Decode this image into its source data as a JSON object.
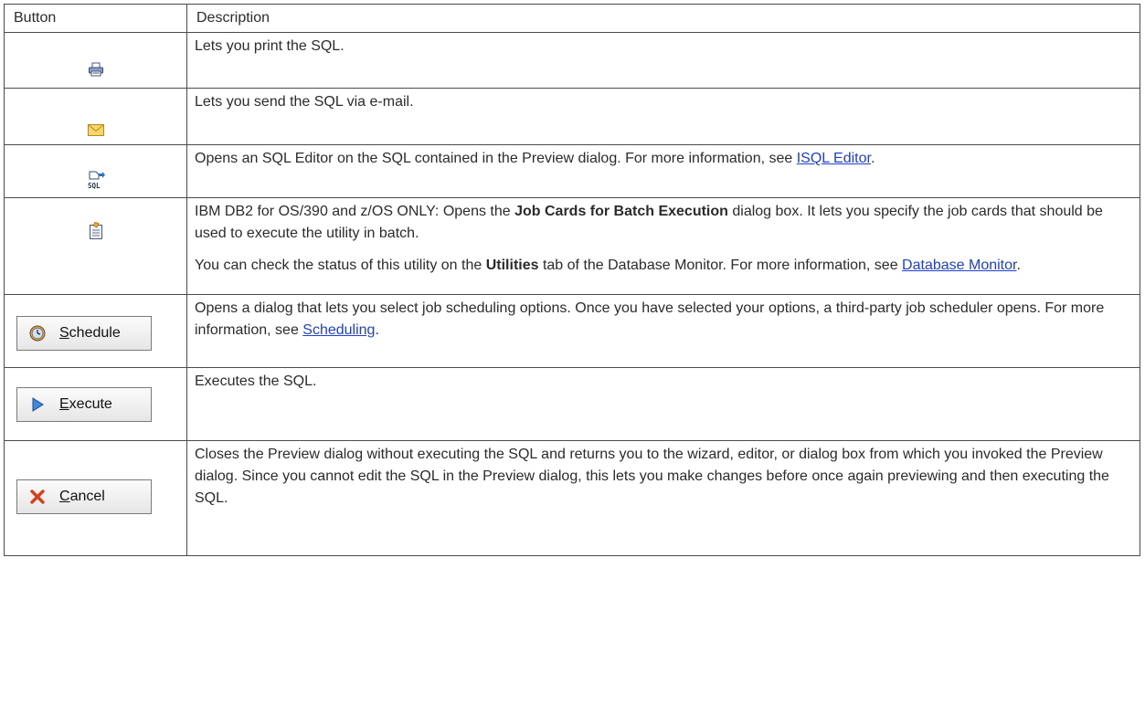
{
  "header": {
    "button_col": "Button",
    "description_col": "Description"
  },
  "rows": [
    {
      "icon": "print-icon",
      "description": "Lets you print the SQL."
    },
    {
      "icon": "email-icon",
      "description": "Lets you send the SQL via e-mail."
    },
    {
      "icon": "open-sql-editor-icon",
      "description_before": "Opens an SQL Editor on the SQL contained in the Preview dialog. For more information, see ",
      "link": "ISQL Editor",
      "description_after": "."
    },
    {
      "icon": "job-cards-icon",
      "p1_before": "IBM DB2 for OS/390 and z/OS ONLY: Opens the ",
      "p1_bold": "Job Cards for Batch Execution",
      "p1_after": " dialog box. It lets you specify the job cards that should be used to execute the utility in batch.",
      "p2_before": "You can check the status of this utility on the ",
      "p2_bold": "Utilities",
      "p2_mid": " tab of the Database Monitor.  For more information, see ",
      "p2_link": "Database Monitor",
      "p2_after": "."
    },
    {
      "button": {
        "label_first": "S",
        "label_rest": "chedule",
        "icon": "clock-icon"
      },
      "description_before": "Opens a dialog that lets you select job scheduling options.  Once you have selected your options, a third-party job scheduler opens. For more information, see ",
      "link": "Scheduling",
      "description_after": "."
    },
    {
      "button": {
        "label_first": "E",
        "label_rest": "xecute",
        "icon": "play-icon"
      },
      "description": "Executes the SQL."
    },
    {
      "button": {
        "label_first": "C",
        "label_rest": "ancel",
        "icon": "x-icon"
      },
      "description": "Closes the Preview dialog without executing the SQL and returns you to the wizard, editor, or dialog box from which you invoked the Preview dialog. Since you cannot edit the SQL in the Preview dialog, this lets you make changes before once again previewing and then executing the SQL."
    }
  ],
  "colors": {
    "link": "#1f3fd0",
    "border": "#4a4a4a",
    "text": "#2b2b2b"
  }
}
